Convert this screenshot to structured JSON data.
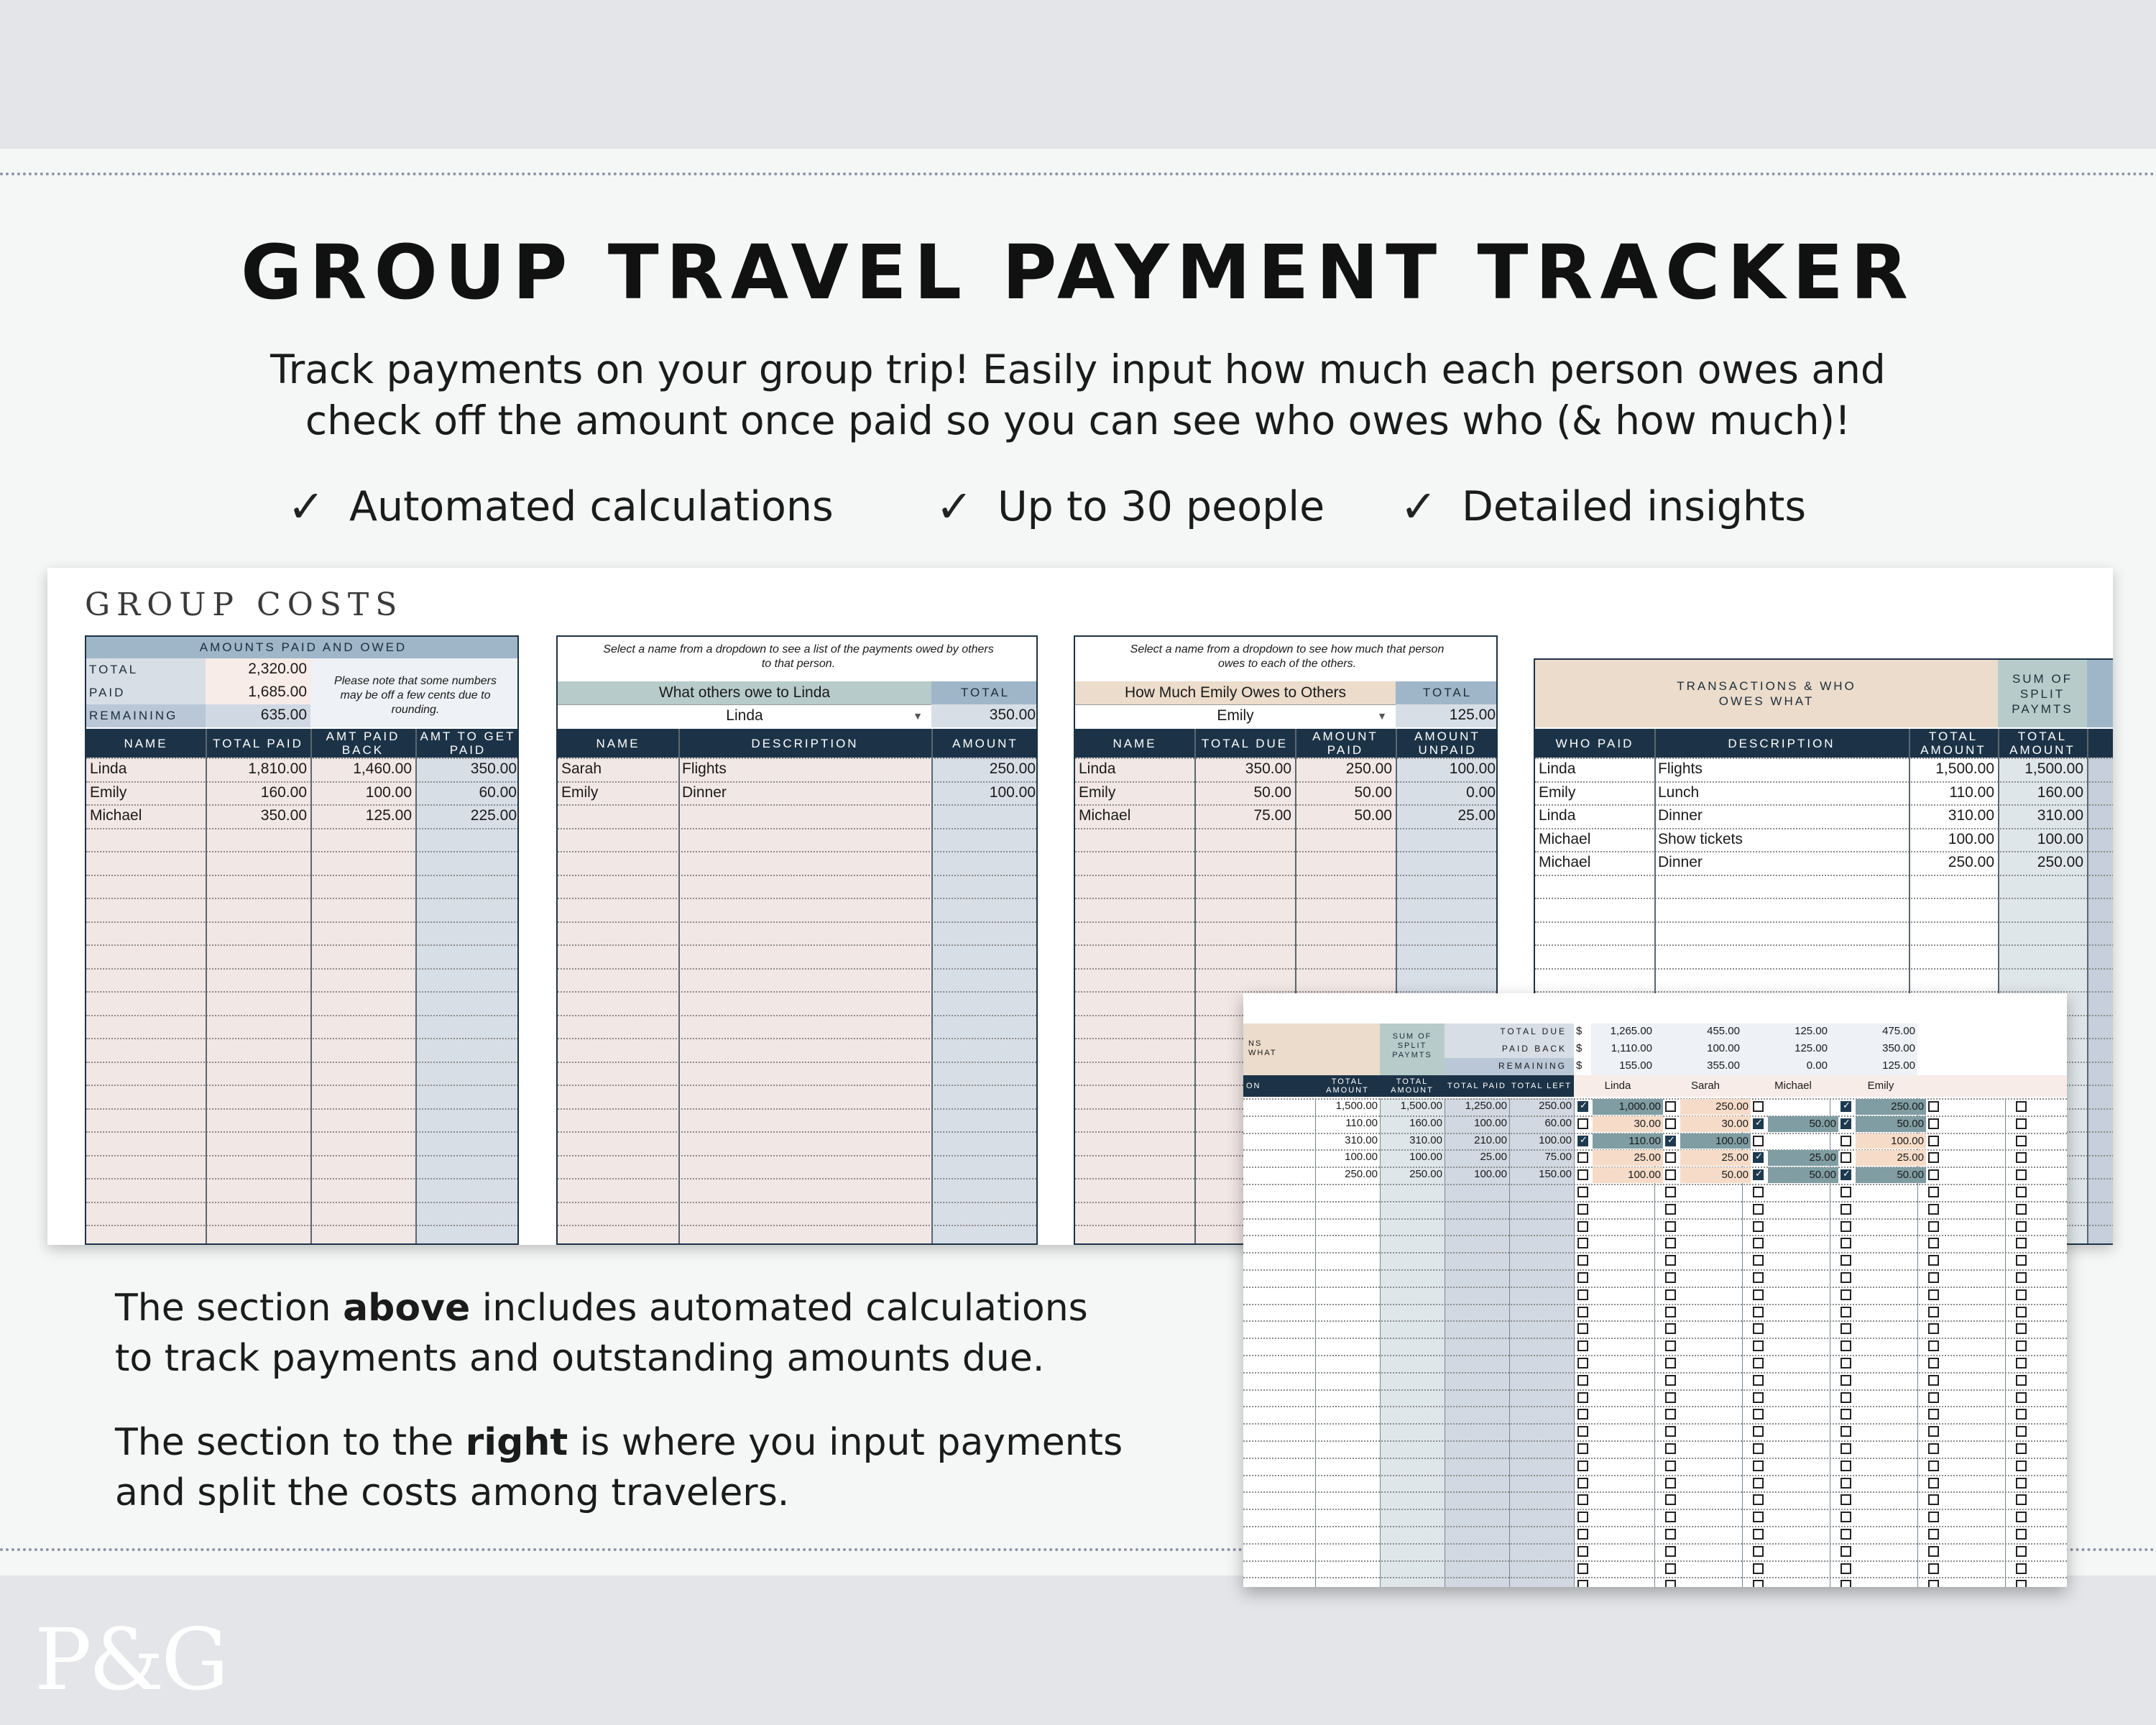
{
  "header": {
    "title": "GROUP TRAVEL PAYMENT TRACKER",
    "subtitle_line1": "Track payments on your group trip! Easily input how much each person owes and",
    "subtitle_line2": "check off the amount once paid so you can see who owes who (& how much)!",
    "features": [
      "Automated calculations",
      "Up to 30 people",
      "Detailed insights"
    ],
    "check_icon": "✓"
  },
  "sheet": {
    "title": "GROUP COSTS",
    "summary": {
      "banner": "AMOUNTS PAID AND OWED",
      "rows": [
        {
          "label": "TOTAL",
          "value": "2,320.00"
        },
        {
          "label": "PAID",
          "value": "1,685.00"
        },
        {
          "label": "REMAINING",
          "value": "635.00"
        }
      ],
      "note": "Please note that some numbers may be off a few cents due to rounding.",
      "headers": [
        "NAME",
        "TOTAL PAID",
        "AMT PAID BACK",
        "AMT TO GET PAID"
      ],
      "rows_data": [
        [
          "Linda",
          "1,810.00",
          "1,460.00",
          "350.00"
        ],
        [
          "Emily",
          "160.00",
          "100.00",
          "60.00"
        ],
        [
          "Michael",
          "350.00",
          "125.00",
          "225.00"
        ]
      ]
    },
    "owed_to": {
      "note": "Select a name from a dropdown to see a list of the payments owed by others to that person.",
      "label": "What others owe to Linda",
      "total_label": "TOTAL",
      "selected": "Linda",
      "total": "350.00",
      "headers": [
        "NAME",
        "DESCRIPTION",
        "AMOUNT"
      ],
      "rows_data": [
        [
          "Sarah",
          "Flights",
          "250.00"
        ],
        [
          "Emily",
          "Dinner",
          "100.00"
        ]
      ]
    },
    "owes_others": {
      "note": "Select a name from a dropdown to see how much that person owes to each of the others.",
      "label": "How Much Emily Owes to Others",
      "total_label": "TOTAL",
      "selected": "Emily",
      "total": "125.00",
      "headers": [
        "NAME",
        "TOTAL DUE",
        "AMOUNT PAID",
        "AMOUNT UNPAID"
      ],
      "rows_data": [
        [
          "Linda",
          "350.00",
          "250.00",
          "100.00"
        ],
        [
          "Emily",
          "50.00",
          "50.00",
          "0.00"
        ],
        [
          "Michael",
          "75.00",
          "50.00",
          "25.00"
        ]
      ]
    },
    "transactions": {
      "banner": "TRANSACTIONS & WHO OWES WHAT",
      "sum_label": "SUM OF SPLIT PAYMTS",
      "headers": [
        "WHO PAID",
        "DESCRIPTION",
        "TOTAL AMOUNT",
        "TOTAL AMOUNT"
      ],
      "rows_data": [
        [
          "Linda",
          "Flights",
          "1,500.00",
          "1,500.00"
        ],
        [
          "Emily",
          "Lunch",
          "110.00",
          "160.00"
        ],
        [
          "Linda",
          "Dinner",
          "310.00",
          "310.00"
        ],
        [
          "Michael",
          "Show tickets",
          "100.00",
          "100.00"
        ],
        [
          "Michael",
          "Dinner",
          "250.00",
          "250.00"
        ]
      ]
    }
  },
  "split_sheet": {
    "banner_fragment": "NS WHAT",
    "sum_label": "SUM OF SPLIT PAYMTS",
    "col_fragment": "ON",
    "summary_labels": [
      "TOTAL DUE",
      "PAID BACK",
      "REMAINING"
    ],
    "currency": "$",
    "summary_values": [
      [
        "1,265.00",
        "455.00",
        "125.00",
        "475.00"
      ],
      [
        "1,110.00",
        "100.00",
        "125.00",
        "350.00"
      ],
      [
        "155.00",
        "355.00",
        "0.00",
        "125.00"
      ]
    ],
    "people": [
      "Linda",
      "Sarah",
      "Michael",
      "Emily"
    ],
    "headers": [
      "TOTAL AMOUNT",
      "TOTAL AMOUNT",
      "TOTAL PAID",
      "TOTAL LEFT"
    ],
    "rows": [
      {
        "vals": [
          "1,500.00",
          "1,500.00",
          "1,250.00",
          "250.00"
        ],
        "splits": [
          "1,000.00",
          "250.00",
          "",
          "250.00"
        ],
        "checks": [
          true,
          false,
          false,
          true
        ]
      },
      {
        "vals": [
          "110.00",
          "160.00",
          "100.00",
          "60.00"
        ],
        "splits": [
          "30.00",
          "30.00",
          "50.00",
          "50.00"
        ],
        "checks": [
          false,
          false,
          true,
          true
        ]
      },
      {
        "vals": [
          "310.00",
          "310.00",
          "210.00",
          "100.00"
        ],
        "splits": [
          "110.00",
          "100.00",
          "",
          "100.00"
        ],
        "checks": [
          true,
          true,
          false,
          false
        ]
      },
      {
        "vals": [
          "100.00",
          "100.00",
          "25.00",
          "75.00"
        ],
        "splits": [
          "25.00",
          "25.00",
          "25.00",
          "25.00"
        ],
        "checks": [
          false,
          false,
          true,
          false
        ]
      },
      {
        "vals": [
          "250.00",
          "250.00",
          "100.00",
          "150.00"
        ],
        "splits": [
          "100.00",
          "50.00",
          "50.00",
          "50.00"
        ],
        "checks": [
          false,
          false,
          true,
          true
        ]
      }
    ]
  },
  "descriptions": {
    "p1_pre": "The section ",
    "p1_bold": "above",
    "p1_post": " includes automated calculations",
    "p1_line2": "to track payments and outstanding amounts due.",
    "p2_pre": "The section to the ",
    "p2_bold": "right",
    "p2_post": " is where you input payments",
    "p2_line2": "and split the costs among travelers."
  },
  "brand": {
    "logo": "P&G"
  },
  "colors": {
    "navy": "#1c3347",
    "pink": "#f1e7e4",
    "blue_gray": "#d8dee6",
    "sage": "#b7ccca",
    "tan": "#ecdccb",
    "steel": "#9fb6c9",
    "teal_dark": "#7f9da3",
    "peach": "#f6dcc8"
  }
}
